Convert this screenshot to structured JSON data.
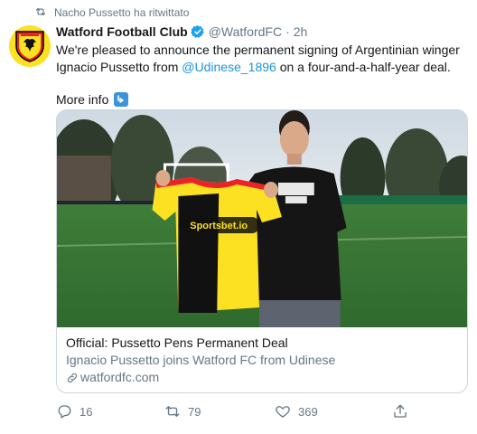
{
  "retweet_header": {
    "text": "Nacho Pussetto ha ritwittato"
  },
  "tweet": {
    "display_name": "Watford Football Club",
    "handle": "@WatfordFC",
    "separator": "·",
    "time": "2h",
    "text_part1": "We're pleased to announce the permanent signing of Argentinian winger Ignacio Pussetto from ",
    "mention": "@Udinese_1896",
    "text_part2": " on a four-and-a-half-year deal.",
    "more_info": "More info"
  },
  "card": {
    "title": "Official: Pussetto Pens Permanent Deal",
    "description": "Ignacio Pussetto joins Watford FC from Udinese",
    "domain": "watfordfc.com",
    "shirt_sponsor": "Sportsbet.io"
  },
  "actions": {
    "replies": "16",
    "retweets": "79",
    "likes": "369"
  },
  "colors": {
    "accent": "#1b95e0",
    "muted": "#657786",
    "watford_yellow": "#fbe122"
  }
}
